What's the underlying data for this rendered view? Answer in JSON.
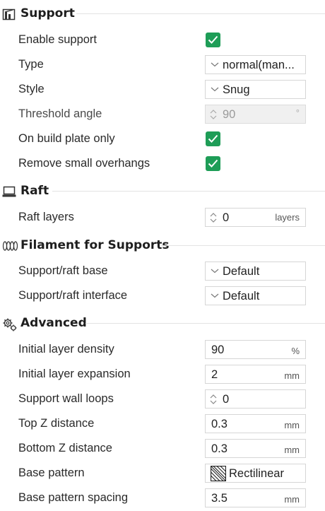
{
  "sections": {
    "support": {
      "title": "Support",
      "icon": "support-icon",
      "enable_support": {
        "label": "Enable support",
        "checked": true
      },
      "type": {
        "label": "Type",
        "value": "normal(man..."
      },
      "style": {
        "label": "Style",
        "value": "Snug"
      },
      "threshold_angle": {
        "label": "Threshold angle",
        "value": "90",
        "unit": "°"
      },
      "on_build_plate_only": {
        "label": "On build plate only",
        "checked": true
      },
      "remove_small_overhangs": {
        "label": "Remove small overhangs",
        "checked": true
      }
    },
    "raft": {
      "title": "Raft",
      "icon": "raft-icon",
      "raft_layers": {
        "label": "Raft layers",
        "value": "0",
        "unit": "layers"
      }
    },
    "filament": {
      "title": "Filament for Supports",
      "icon": "filament-icon",
      "base": {
        "label": "Support/raft base",
        "value": "Default"
      },
      "interface": {
        "label": "Support/raft interface",
        "value": "Default"
      }
    },
    "advanced": {
      "title": "Advanced",
      "icon": "gears-icon",
      "initial_layer_density": {
        "label": "Initial layer density",
        "value": "90",
        "unit": "%"
      },
      "initial_layer_expansion": {
        "label": "Initial layer expansion",
        "value": "2",
        "unit": "mm"
      },
      "support_wall_loops": {
        "label": "Support wall loops",
        "value": "0"
      },
      "top_z_distance": {
        "label": "Top Z distance",
        "value": "0.3",
        "unit": "mm"
      },
      "bottom_z_distance": {
        "label": "Bottom Z distance",
        "value": "0.3",
        "unit": "mm"
      },
      "base_pattern": {
        "label": "Base pattern",
        "value": "Rectilinear"
      },
      "base_pattern_spacing": {
        "label": "Base pattern spacing",
        "value": "3.5",
        "unit": "mm"
      }
    }
  },
  "colors": {
    "accent": "#1e9d57",
    "border": "#d6d6d6",
    "disabled_bg": "#f0f0f0"
  }
}
